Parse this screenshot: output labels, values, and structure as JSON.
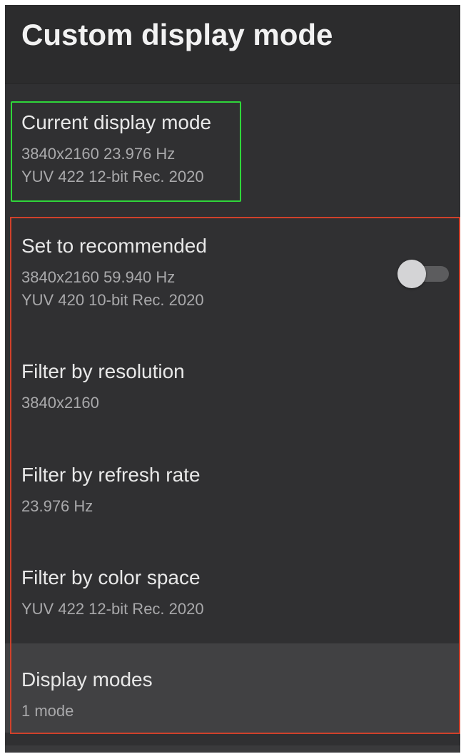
{
  "header": {
    "title": "Custom display mode"
  },
  "current_mode": {
    "title": "Current display mode",
    "line1": "3840x2160 23.976 Hz",
    "line2": "YUV 422 12-bit Rec. 2020"
  },
  "items": {
    "set_recommended": {
      "title": "Set to recommended",
      "line1": "3840x2160 59.940 Hz",
      "line2": "YUV 420 10-bit Rec. 2020",
      "toggle_on": false
    },
    "filter_resolution": {
      "title": "Filter by resolution",
      "value": "3840x2160"
    },
    "filter_refresh": {
      "title": "Filter by refresh rate",
      "value": "23.976 Hz"
    },
    "filter_color": {
      "title": "Filter by color space",
      "value": "YUV 422 12-bit Rec. 2020"
    },
    "display_modes": {
      "title": "Display modes",
      "value": "1 mode"
    }
  },
  "colors": {
    "background": "#303032",
    "current_highlight": "#2fd63a",
    "group_highlight": "#d0412b",
    "focused_row": "#414143"
  }
}
